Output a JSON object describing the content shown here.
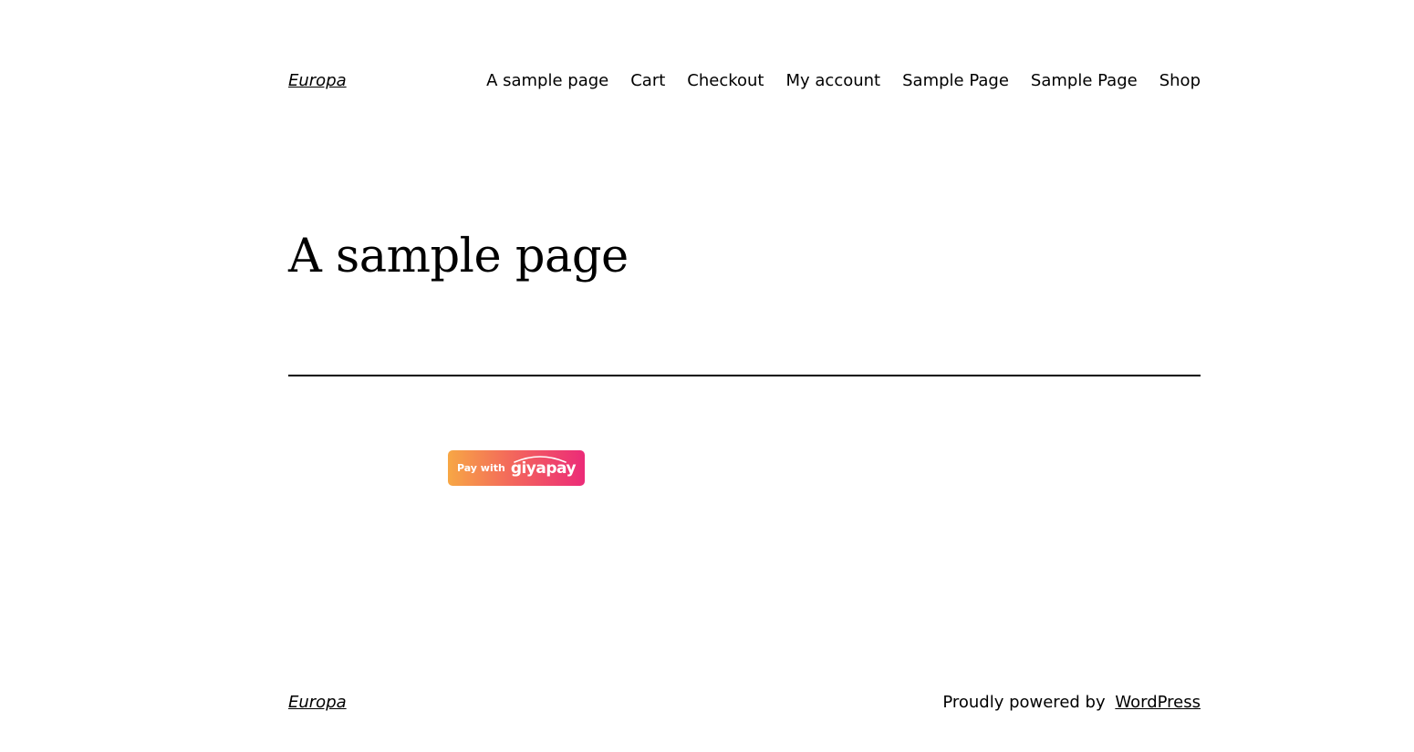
{
  "header": {
    "site_title": "Europa",
    "nav": [
      {
        "label": "A sample page"
      },
      {
        "label": "Cart"
      },
      {
        "label": "Checkout"
      },
      {
        "label": "My account"
      },
      {
        "label": "Sample Page"
      },
      {
        "label": "Sample Page"
      },
      {
        "label": "Shop"
      }
    ]
  },
  "main": {
    "page_title": "A sample page",
    "pay_button": {
      "prefix": "Pay with",
      "brand": "giyapay",
      "gradient_start": "#f7a745",
      "gradient_end": "#ec2b78"
    }
  },
  "footer": {
    "site_title": "Europa",
    "credit_text": "Proudly powered by",
    "credit_link": "WordPress"
  }
}
